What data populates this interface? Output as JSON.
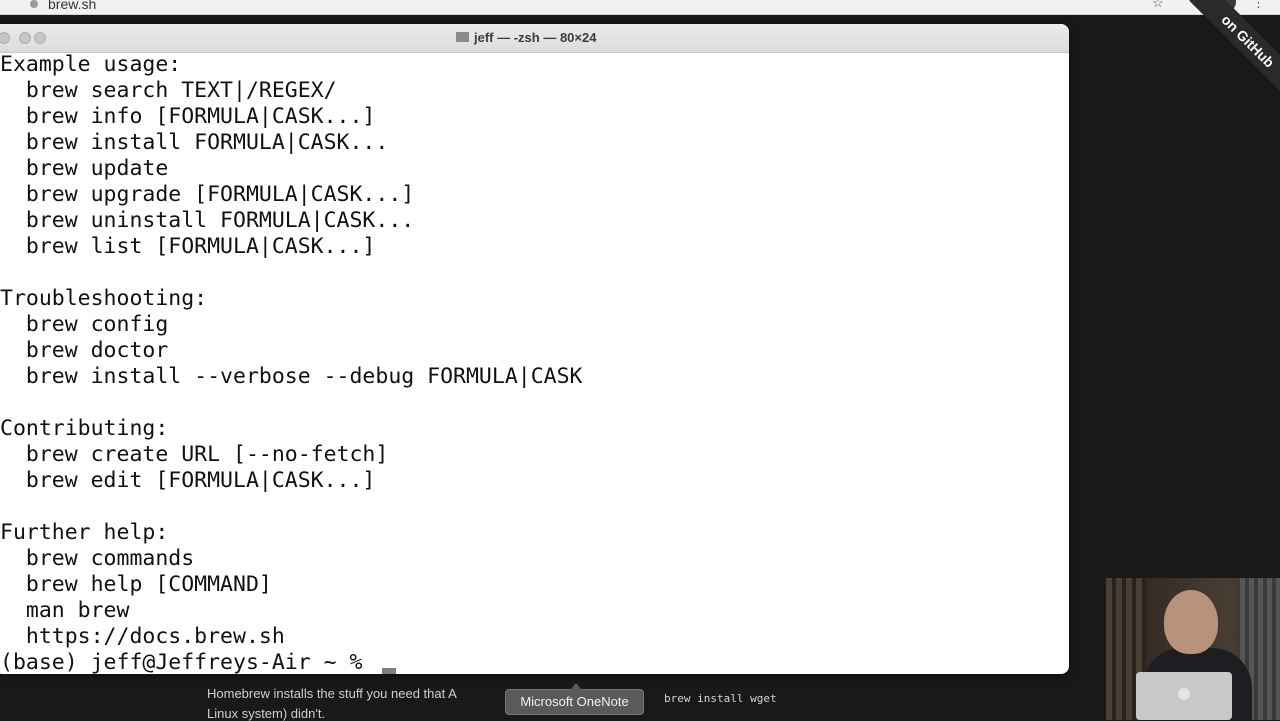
{
  "browser": {
    "tab_title": "brew.sh",
    "ribbon_text": "on GitHub"
  },
  "terminal": {
    "window_title": "jeff — -zsh — 80×24",
    "lines": [
      "Example usage:",
      "  brew search TEXT|/REGEX/",
      "  brew info [FORMULA|CASK...]",
      "  brew install FORMULA|CASK...",
      "  brew update",
      "  brew upgrade [FORMULA|CASK...]",
      "  brew uninstall FORMULA|CASK...",
      "  brew list [FORMULA|CASK...]",
      "",
      "Troubleshooting:",
      "  brew config",
      "  brew doctor",
      "  brew install --verbose --debug FORMULA|CASK",
      "",
      "Contributing:",
      "  brew create URL [--no-fetch]",
      "  brew edit [FORMULA|CASK...]",
      "",
      "Further help:",
      "  brew commands",
      "  brew help [COMMAND]",
      "  man brew",
      "  https://docs.brew.sh",
      "(base) jeff@Jeffreys-Air ~ % "
    ]
  },
  "page": {
    "caption_line1": "Homebrew installs the stuff you need that A",
    "caption_line2": "Linux system) didn't.",
    "code_snippet": "brew install wget"
  },
  "tooltip": {
    "label": "Microsoft OneNote"
  }
}
